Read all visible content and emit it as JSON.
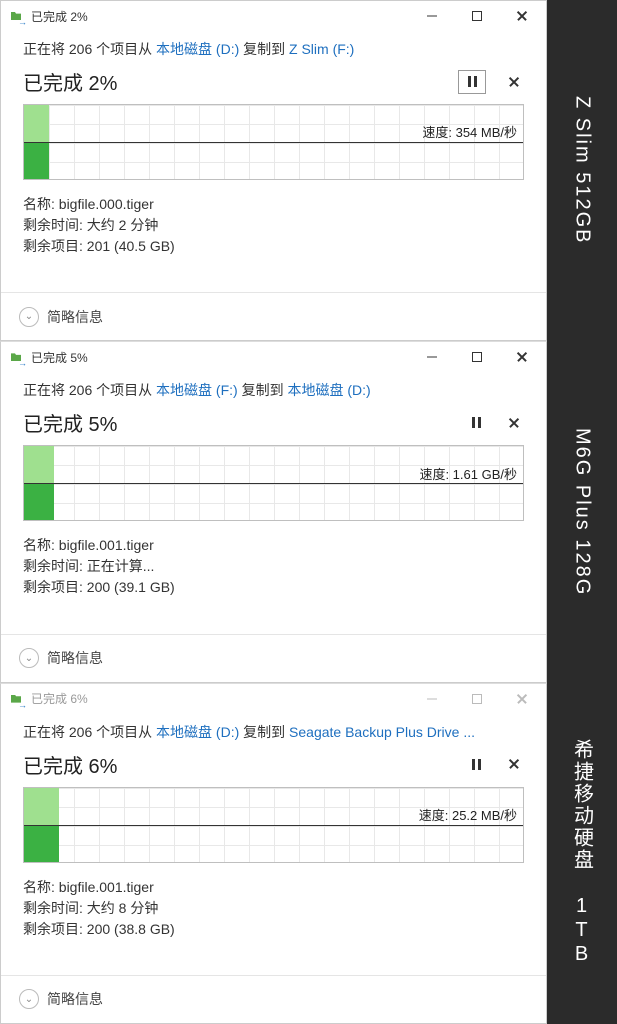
{
  "right_labels": [
    "Z Slim 512GB",
    "M6G Plus 128G",
    "希捷移动硬盘 1TB"
  ],
  "dialogs": [
    {
      "active": true,
      "title": "已完成 2%",
      "copy_prefix": "正在将 206 个项目从 ",
      "src": "本地磁盘 (D:)",
      "copy_mid": " 复制到 ",
      "dst": "Z Slim (F:)",
      "status": "已完成 2%",
      "speed_label": "速度: 354 MB/秒",
      "fill_width": "5%",
      "name_label": "名称: ",
      "name_value": "bigfile.000.tiger",
      "time_label": "剩余时间: ",
      "time_value": "大约 2 分钟",
      "items_label": "剩余项目: ",
      "items_value": "201 (40.5 GB)",
      "footer": "简略信息",
      "pause_border": true
    },
    {
      "active": true,
      "title": "已完成 5%",
      "copy_prefix": "正在将 206 个项目从 ",
      "src": "本地磁盘 (F:)",
      "copy_mid": " 复制到 ",
      "dst": "本地磁盘 (D:)",
      "status": "已完成 5%",
      "speed_label": "速度: 1.61 GB/秒",
      "fill_width": "6%",
      "name_label": "名称: ",
      "name_value": "bigfile.001.tiger",
      "time_label": "剩余时间: ",
      "time_value": "正在计算...",
      "items_label": "剩余项目: ",
      "items_value": "200 (39.1 GB)",
      "footer": "简略信息",
      "pause_border": false
    },
    {
      "active": false,
      "title": "已完成 6%",
      "copy_prefix": "正在将 206 个项目从 ",
      "src": "本地磁盘 (D:)",
      "copy_mid": " 复制到 ",
      "dst": "Seagate Backup Plus Drive ...",
      "status": "已完成 6%",
      "speed_label": "速度: 25.2 MB/秒",
      "fill_width": "7%",
      "name_label": "名称: ",
      "name_value": "bigfile.001.tiger",
      "time_label": "剩余时间: ",
      "time_value": "大约 8 分钟",
      "items_label": "剩余项目: ",
      "items_value": "200 (38.8 GB)",
      "footer": "简略信息",
      "pause_border": false
    }
  ],
  "chart_data": [
    {
      "type": "area",
      "title": "Copy speed",
      "ylabel": "MB/秒",
      "x": [
        0,
        1
      ],
      "values": [
        354,
        354
      ],
      "ylim": [
        0,
        700
      ]
    },
    {
      "type": "area",
      "title": "Copy speed",
      "ylabel": "GB/秒",
      "x": [
        0,
        1
      ],
      "values": [
        1.61,
        1.61
      ],
      "ylim": [
        0,
        3.2
      ]
    },
    {
      "type": "area",
      "title": "Copy speed",
      "ylabel": "MB/秒",
      "x": [
        0,
        1
      ],
      "values": [
        25.2,
        25.2
      ],
      "ylim": [
        0,
        50
      ]
    }
  ]
}
